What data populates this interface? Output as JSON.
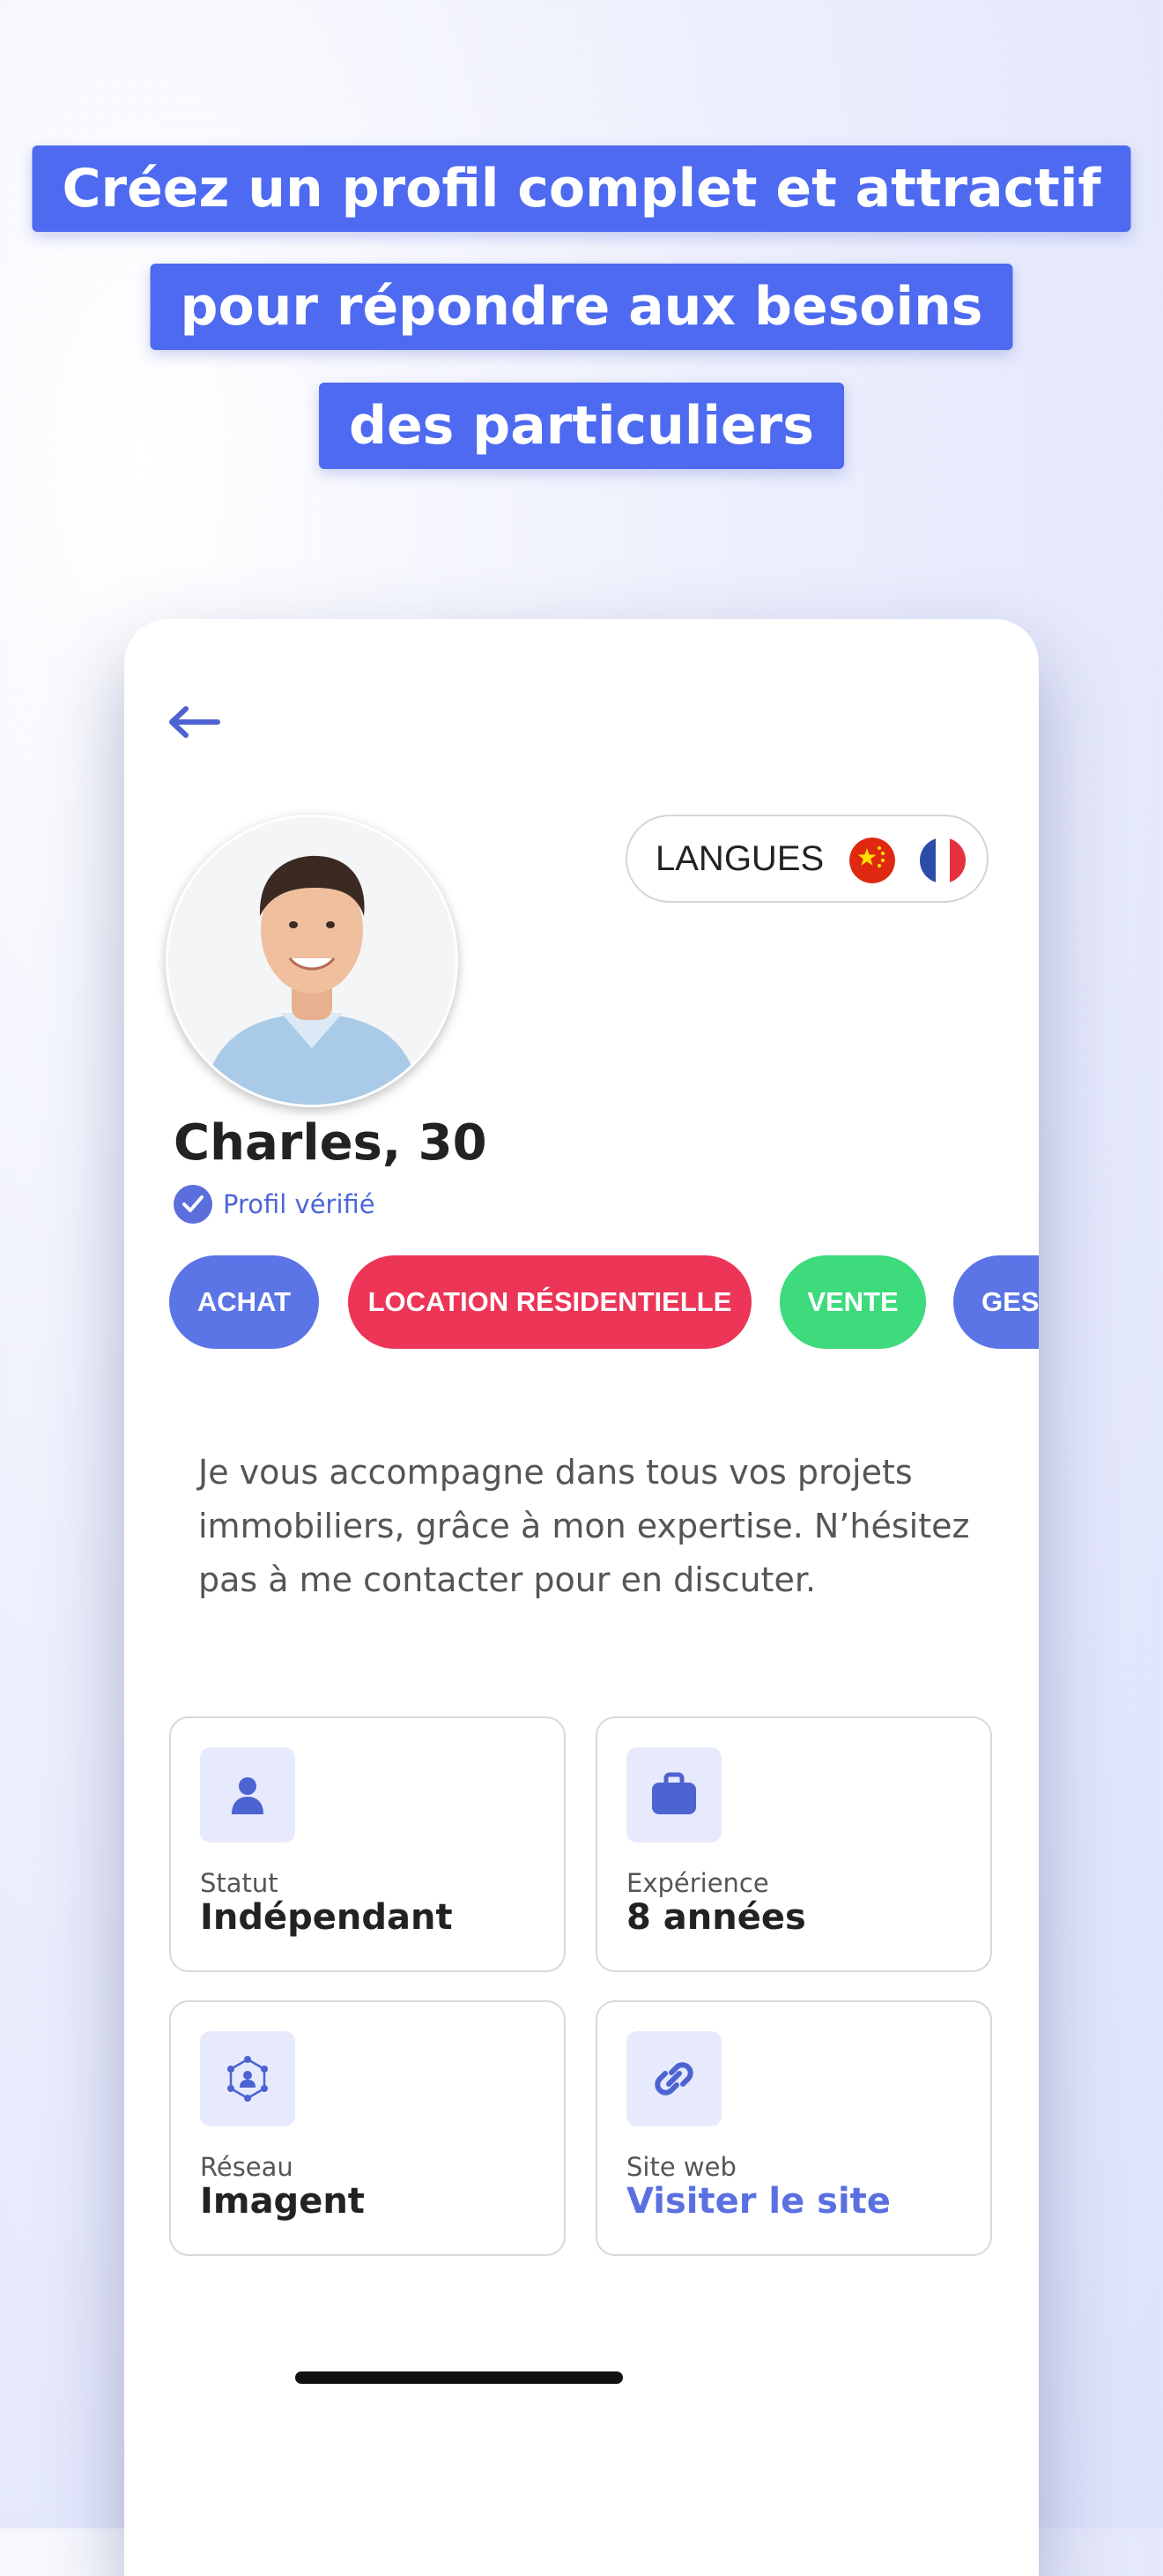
{
  "headline": {
    "line1": "Créez un profil complet et attractif",
    "line2": "pour répondre aux besoins",
    "line3": "des particuliers"
  },
  "profile": {
    "back_icon": "arrow-left-icon",
    "languages_label": "LANGUES",
    "languages": [
      "chinese-flag-icon",
      "french-flag-icon"
    ],
    "name": "Charles, 30",
    "verified_text": "Profil vérifié",
    "tags": [
      {
        "label": "ACHAT",
        "color": "#5b74e6"
      },
      {
        "label": "LOCATION RÉSIDENTIELLE",
        "color": "#ec3557"
      },
      {
        "label": "VENTE",
        "color": "#3ddb7b"
      },
      {
        "label": "GESTION",
        "color": "#5b74e6"
      }
    ],
    "bio": "Je vous accompagne dans tous vos projets immobiliers, grâce à mon expertise. N’hésitez pas à me contacter pour en discuter.",
    "cards": [
      {
        "label": "Statut",
        "value": "Indépendant",
        "icon": "user-icon"
      },
      {
        "label": "Expérience",
        "value": "8 années",
        "icon": "briefcase-icon"
      },
      {
        "label": "Réseau",
        "value": "Imagent",
        "icon": "network-icon"
      },
      {
        "label": "Site web",
        "value": "Visiter le site",
        "icon": "link-icon"
      }
    ]
  },
  "colors": {
    "accent": "#4d6af0",
    "icon_bg": "#e6eafc",
    "icon_fg": "#4d63d1"
  }
}
